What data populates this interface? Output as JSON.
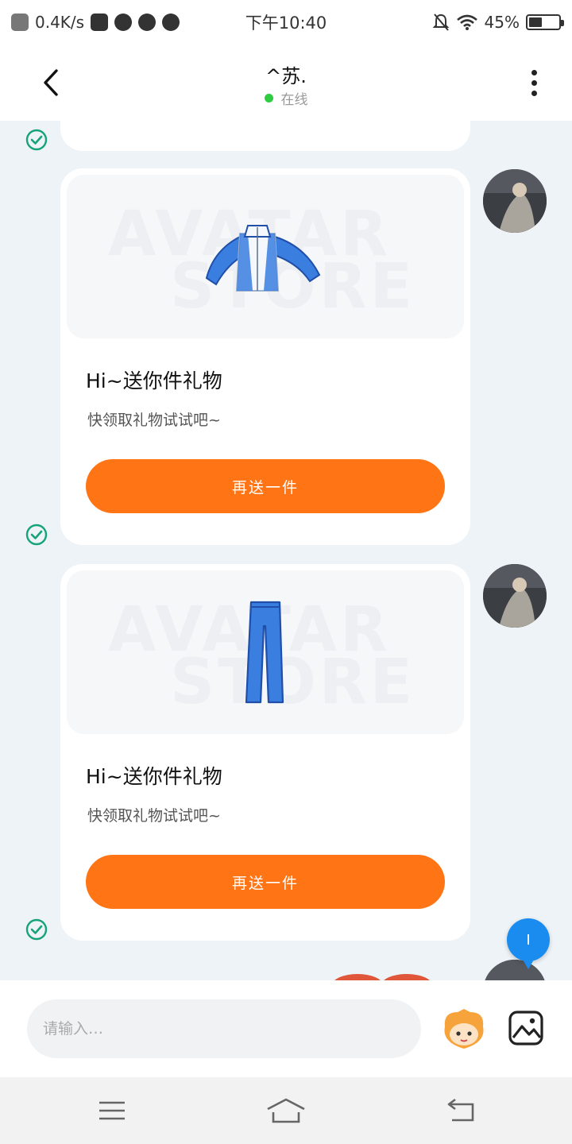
{
  "status_bar": {
    "network_speed": "0.4K/s",
    "time": "下午10:40",
    "battery_percent": "45%",
    "battery_level": 0.45
  },
  "header": {
    "title": "^苏.",
    "status": "在线"
  },
  "messages": [
    {
      "item": "jacket",
      "watermark_line1": "AVATAR",
      "watermark_line2": "STORE",
      "title": "Hi~送你件礼物",
      "subtitle": "快领取礼物试试吧~",
      "button_label": "再送一件"
    },
    {
      "item": "pants",
      "watermark_line1": "AVATAR",
      "watermark_line2": "STORE",
      "title": "Hi~送你件礼物",
      "subtitle": "快领取礼物试试吧~",
      "button_label": "再送一件"
    }
  ],
  "floating_bubble": {
    "label": "I"
  },
  "input_bar": {
    "placeholder": "请输入…"
  },
  "colors": {
    "accent": "#ff7414",
    "online": "#2ecc40",
    "check": "#16a37a",
    "bubble": "#1a8cf0",
    "chat_bg": "#eef3f7"
  }
}
